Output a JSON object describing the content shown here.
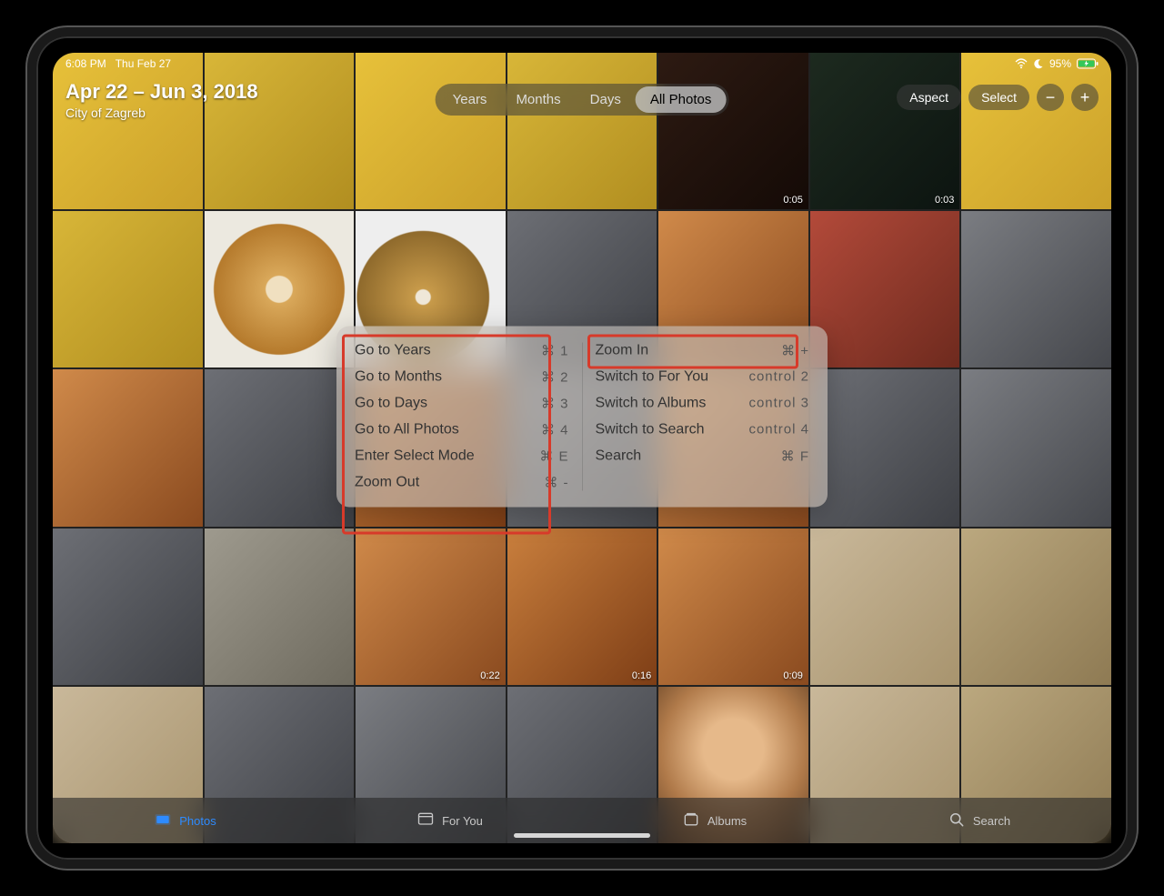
{
  "status": {
    "time": "6:08 PM",
    "date": "Thu Feb 27",
    "battery": "95%"
  },
  "header": {
    "title": "Apr 22 – Jun 3, 2018",
    "subtitle": "City of Zagreb"
  },
  "segmented": {
    "years": "Years",
    "months": "Months",
    "days": "Days",
    "all": "All Photos"
  },
  "toolbar": {
    "aspect": "Aspect",
    "select": "Select",
    "minus": "−",
    "plus": "+"
  },
  "grid": {
    "durations": {
      "r0c4": "0:05",
      "r0c5": "0:03",
      "r3c2": "0:22",
      "r3c3": "0:16",
      "r3c4": "0:09"
    }
  },
  "hud": {
    "left": [
      {
        "label": "Go to Years",
        "keys": "⌘ 1"
      },
      {
        "label": "Go to Months",
        "keys": "⌘ 2"
      },
      {
        "label": "Go to Days",
        "keys": "⌘ 3"
      },
      {
        "label": "Go to All Photos",
        "keys": "⌘ 4"
      },
      {
        "label": "Enter Select Mode",
        "keys": "⌘ E"
      },
      {
        "label": "Zoom Out",
        "keys": "⌘ -"
      }
    ],
    "right": [
      {
        "label": "Zoom In",
        "keys": "⌘ +"
      },
      {
        "label": "Switch to For You",
        "keys": "control 2"
      },
      {
        "label": "Switch to Albums",
        "keys": "control 3"
      },
      {
        "label": "Switch to Search",
        "keys": "control 4"
      },
      {
        "label": "Search",
        "keys": "⌘ F"
      }
    ]
  },
  "tabs": {
    "photos": "Photos",
    "foryou": "For You",
    "albums": "Albums",
    "search": "Search"
  }
}
